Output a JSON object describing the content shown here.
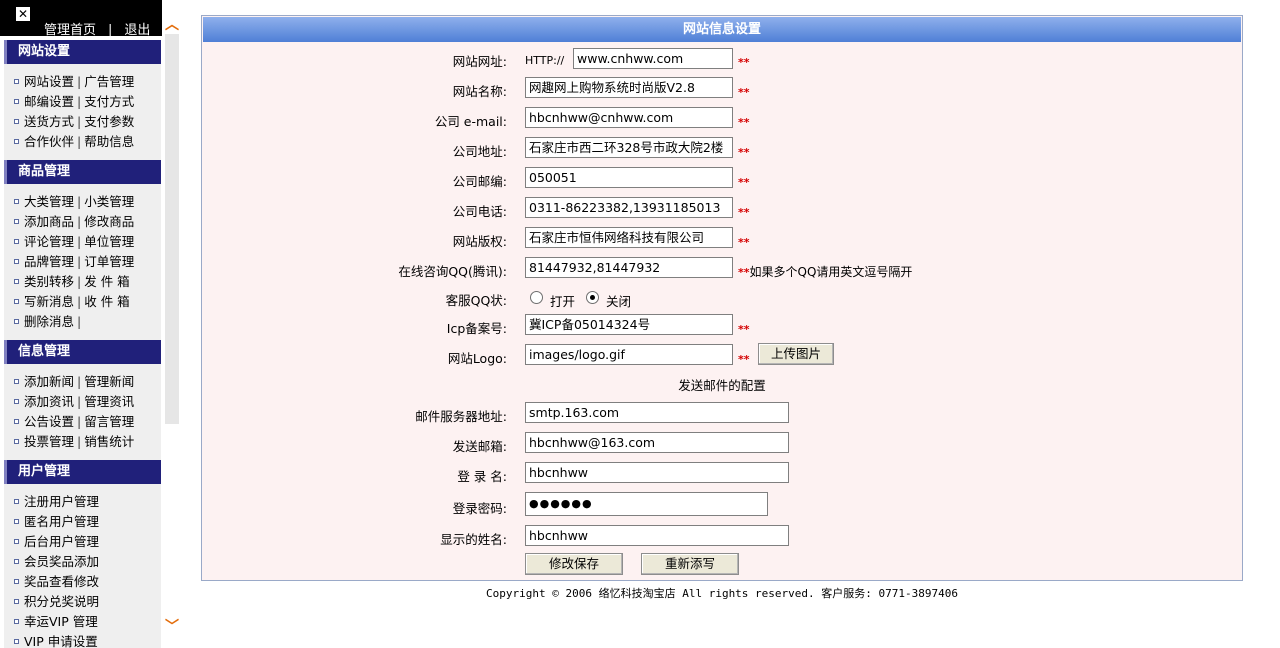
{
  "top": {
    "close_glyph": "✕",
    "home": "管理首页",
    "sep": "|",
    "logout": "退出"
  },
  "sidebar": [
    {
      "title": "网站设置",
      "rows": [
        [
          "网站设置",
          "广告管理"
        ],
        [
          "邮编设置",
          "支付方式"
        ],
        [
          "送货方式",
          "支付参数"
        ],
        [
          "合作伙伴",
          "帮助信息"
        ]
      ]
    },
    {
      "title": "商品管理",
      "rows": [
        [
          "大类管理",
          "小类管理"
        ],
        [
          "添加商品",
          "修改商品"
        ],
        [
          "评论管理",
          "单位管理"
        ],
        [
          "品牌管理",
          "订单管理"
        ],
        [
          "类别转移",
          "发 件 箱"
        ],
        [
          "写新消息",
          "收 件 箱"
        ],
        [
          "删除消息",
          ""
        ]
      ]
    },
    {
      "title": "信息管理",
      "rows": [
        [
          "添加新闻",
          "管理新闻"
        ],
        [
          "添加资讯",
          "管理资讯"
        ],
        [
          "公告设置",
          "留言管理"
        ],
        [
          "投票管理",
          "销售统计"
        ]
      ]
    },
    {
      "title": "用户管理",
      "rows": [
        [
          "注册用户管理"
        ],
        [
          "匿名用户管理"
        ],
        [
          "后台用户管理"
        ],
        [
          "会员奖品添加"
        ],
        [
          "奖品查看修改"
        ],
        [
          "积分兑奖说明"
        ],
        [
          "幸运VIP 管理"
        ],
        [
          "VIP 申请设置"
        ]
      ]
    }
  ],
  "icons": {
    "scroll_up": "chevron-up-icon",
    "scroll_down": "chevron-down-icon"
  },
  "form": {
    "title": "网站信息设置",
    "url_label": "网站网址:",
    "url_prefix": "HTTP://",
    "url_value": "www.cnhww.com",
    "name_label": "网站名称:",
    "name_value": "网趣网上购物系统时尚版V2.8",
    "email_label": "公司 e-mail:",
    "email_value": "hbcnhww@cnhww.com",
    "addr_label": "公司地址:",
    "addr_value": "石家庄市西二环328号市政大院2楼",
    "zip_label": "公司邮编:",
    "zip_value": "050051",
    "phone_label": "公司电话:",
    "phone_value": "0311-86223382,13931185013",
    "copyright_label": "网站版权:",
    "copyright_value": "石家庄市恒伟网络科技有限公司",
    "qq_label": "在线咨询QQ(腾讯):",
    "qq_value": "81447932,81447932",
    "qq_note": "如果多个QQ请用英文逗号隔开",
    "kf_label": "客服QQ状:",
    "kf_open": "打开",
    "kf_close": "关闭",
    "kf_selected": "关闭",
    "icp_label": "Icp备案号:",
    "icp_value": "冀ICP备05014324号",
    "logo_label": "网站Logo:",
    "logo_value": "images/logo.gif",
    "upload_btn": "上传图片",
    "mail_section": "发送邮件的配置",
    "smtp_label": "邮件服务器地址:",
    "smtp_value": "smtp.163.com",
    "sender_label": "发送邮箱:",
    "sender_value": "hbcnhww@163.com",
    "login_label": "登 录 名:",
    "login_value": "hbcnhww",
    "pwd_label": "登录密码:",
    "pwd_value": "●●●●●●",
    "display_label": "显示的姓名:",
    "display_value": "hbcnhww",
    "required_mark": "**",
    "save_btn": "修改保存",
    "reset_btn": "重新添写"
  },
  "footer": "Copyright © 2006 络忆科技淘宝店 All rights reserved. 客户服务: 0771-3897406"
}
